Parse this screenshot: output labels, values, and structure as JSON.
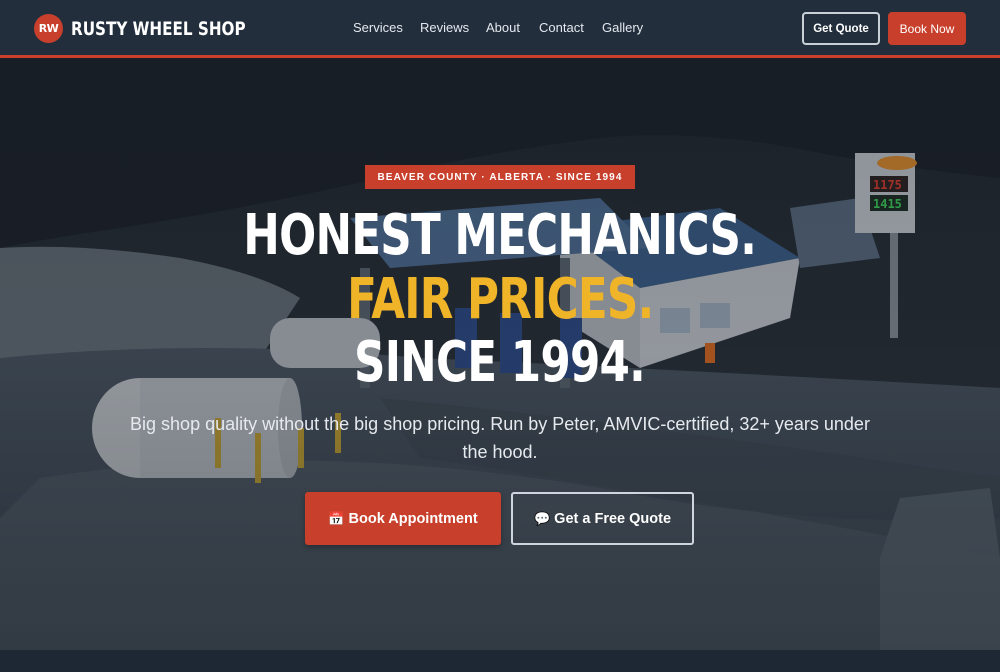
{
  "brand": {
    "logo_text": "RW",
    "name": "RUSTY WHEEL SHOP"
  },
  "nav": {
    "links": [
      "Services",
      "Reviews",
      "About",
      "Contact",
      "Gallery"
    ],
    "get_quote_label": "Get Quote",
    "book_now_label": "Book Now"
  },
  "hero": {
    "badge": "BEAVER COUNTY · ALBERTA · SINCE 1994",
    "headline_line1": "HONEST MECHANICS.",
    "headline_line2": "FAIR PRICES.",
    "headline_line3": "SINCE 1994.",
    "subhead": "Big shop quality without the big shop pricing. Run by Peter, AMVIC-certified, 32+ years under the hood.",
    "book_button": {
      "icon": "📅",
      "label": "Book Appointment"
    },
    "quote_button": {
      "icon": "💬",
      "label": "Get a Free Quote"
    },
    "sign_price_1": "1175",
    "sign_price_2": "1415"
  },
  "colors": {
    "accent_red": "#c8402c",
    "accent_yellow": "#f0b429",
    "nav_bg": "#222e3c"
  }
}
